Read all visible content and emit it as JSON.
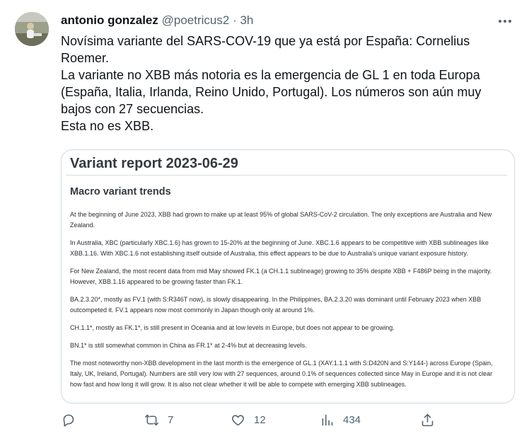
{
  "author": {
    "name": "antonio gonzalez",
    "handle": "@poetricus2",
    "separator": "·",
    "time": "3h"
  },
  "tweet": {
    "lines": [
      "Novísima variante del SARS-COV-19 que ya está por España: Cornelius Roemer.",
      "La variante no XBB más notoria es la emergencia de GL 1 en toda Europa (España, Italia, Irlanda, Reino Unido, Portugal). Los números son aún muy bajos con 27 secuencias.",
      "Esta no es XBB."
    ]
  },
  "media": {
    "title": "Variant report 2023-06-29",
    "subtitle": "Macro variant trends",
    "paragraphs": [
      "At the beginning of June 2023, XBB had grown to make up at least 95% of global SARS-CoV-2 circulation. The only exceptions are Australia and New Zealand.",
      "In Australia, XBC (particularly XBC.1.6) has grown to 15-20% at the beginning of June. XBC.1.6 appears to be competitive with XBB sublineages like XBB.1.16. With XBC.1.6 not establishing itself outside of Australia, this effect appears to be due to Australia's unique variant exposure history.",
      "For New Zealand, the most recent data from mid May showed FK.1 (a CH.1.1 sublineage) growing to 35% despite XBB + F486P being in the majority. However, XBB.1.16 appeared to be growing faster than FK.1.",
      "BA.2.3.20*, mostly as FV.1 (with S:R346T now), is slowly disappearing. In the Philippines, BA.2.3.20 was dominant until February 2023 when XBB outcompeted it. FV.1 appears now most commonly in Japan though only at around 1%.",
      "CH.1.1*, mostly as FK.1*, is still present in Oceania and at low levels in Europe, but does not appear to be growing.",
      "BN.1* is still somewhat common in China as FR.1* at 2-4% but at decreasing levels.",
      "The most noteworthy non-XBB development in the last month is the emergence of GL.1 (XAY.1.1.1 with S:D420N and S:Y144-) across Europe (Spain, Italy, UK, Ireland, Portugal). Numbers are still very low with 27 sequences, around 0.1% of sequences collected since May in Europe and it is not clear how fast and how long it will grow. It is also not clear whether it will be able to compete with emerging XBB sublineages."
    ]
  },
  "actions": {
    "reply": {
      "icon": "reply-icon",
      "count": ""
    },
    "retweet": {
      "icon": "retweet-icon",
      "count": "7"
    },
    "like": {
      "icon": "heart-icon",
      "count": "12"
    },
    "views": {
      "icon": "views-icon",
      "count": "434"
    },
    "share": {
      "icon": "share-icon",
      "count": ""
    }
  },
  "colors": {
    "text": "#0f1419",
    "secondary": "#536471",
    "border": "#cfd9de"
  }
}
